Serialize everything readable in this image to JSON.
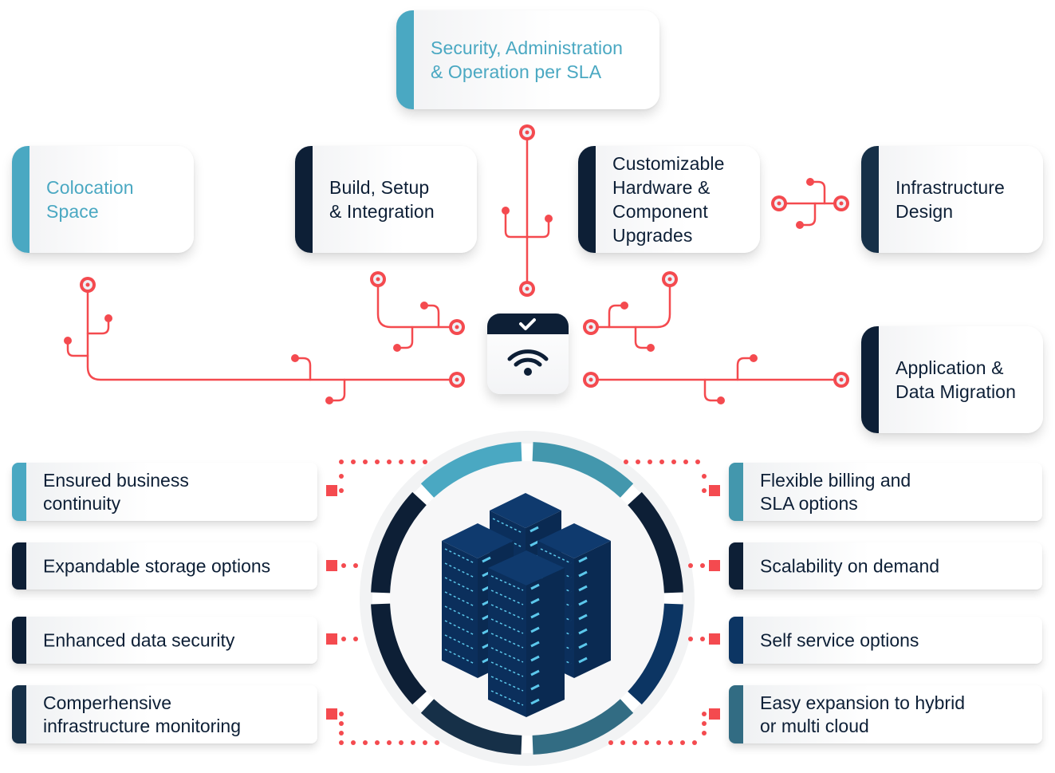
{
  "colors": {
    "accent_red": "#f44a4f",
    "teal": "#4aa8c2",
    "teal_mid": "#4397ad",
    "navy": "#0d1f36",
    "navy_mid": "#163048",
    "navy_blue": "#0c3563",
    "slate_teal": "#326c83"
  },
  "services": [
    {
      "id": "security",
      "lines": [
        "Security, Administration",
        "& Operation per SLA"
      ],
      "style": "teal"
    },
    {
      "id": "colocation",
      "lines": [
        "Colocation",
        "Space"
      ],
      "style": "teal"
    },
    {
      "id": "build",
      "lines": [
        "Build, Setup",
        "& Integration"
      ],
      "style": "navy"
    },
    {
      "id": "hardware",
      "lines": [
        "Customizable",
        "Hardware &",
        "Component",
        "Upgrades"
      ],
      "style": "navy"
    },
    {
      "id": "infra",
      "lines": [
        "Infrastructure",
        "Design"
      ],
      "style": "navy"
    },
    {
      "id": "migration",
      "lines": [
        "Application &",
        "Data Migration"
      ],
      "style": "navy"
    }
  ],
  "hub": {
    "top_icon": "checkmark-icon",
    "main_icon": "wifi-icon"
  },
  "center": {
    "icon": "server-racks-icon"
  },
  "benefits_left": [
    {
      "lines": [
        "Ensured business",
        "continuity"
      ]
    },
    {
      "lines": [
        "Expandable storage options"
      ]
    },
    {
      "lines": [
        "Enhanced data security"
      ]
    },
    {
      "lines": [
        "Comperhensive",
        "infrastructure monitoring"
      ]
    }
  ],
  "benefits_right": [
    {
      "lines": [
        "Flexible billing and",
        "SLA options"
      ]
    },
    {
      "lines": [
        "Scalability on demand"
      ]
    },
    {
      "lines": [
        "Self service options"
      ]
    },
    {
      "lines": [
        "Easy expansion to hybrid",
        "or multi cloud"
      ]
    }
  ]
}
